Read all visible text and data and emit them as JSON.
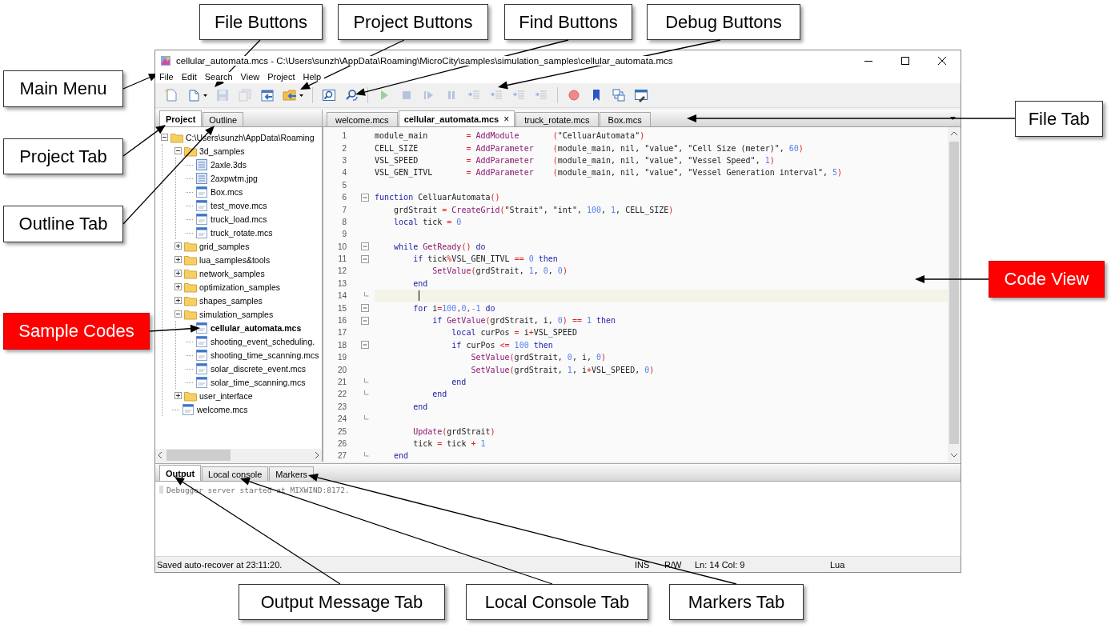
{
  "window": {
    "title": "cellular_automata.mcs - C:\\Users\\sunzh\\AppData\\Roaming\\MicroCity\\samples\\simulation_samples\\cellular_automata.mcs"
  },
  "menu": [
    "File",
    "Edit",
    "Search",
    "View",
    "Project",
    "Help"
  ],
  "toolbar": [
    {
      "kind": "new",
      "disabled": false
    },
    {
      "kind": "open",
      "disabled": false,
      "dropdown": true
    },
    {
      "kind": "save",
      "disabled": true
    },
    {
      "kind": "save-all",
      "disabled": true
    },
    {
      "kind": "import",
      "disabled": false
    },
    {
      "kind": "project",
      "disabled": false,
      "dropdown": true
    },
    {
      "kind": "sep"
    },
    {
      "kind": "find",
      "disabled": false
    },
    {
      "kind": "find-replace",
      "disabled": false
    },
    {
      "kind": "sep"
    },
    {
      "kind": "run",
      "disabled": true
    },
    {
      "kind": "stop",
      "disabled": true
    },
    {
      "kind": "step",
      "disabled": true
    },
    {
      "kind": "pause",
      "disabled": true
    },
    {
      "kind": "lines",
      "disabled": true
    },
    {
      "kind": "lines",
      "disabled": true
    },
    {
      "kind": "lines",
      "disabled": true
    },
    {
      "kind": "lines",
      "disabled": true
    },
    {
      "kind": "sep"
    },
    {
      "kind": "breakpoint",
      "disabled": false
    },
    {
      "kind": "bookmark",
      "disabled": false
    },
    {
      "kind": "windows",
      "disabled": false
    },
    {
      "kind": "window-edit",
      "disabled": false
    }
  ],
  "side_tabs": [
    {
      "label": "Project",
      "selected": true
    },
    {
      "label": "Outline",
      "selected": false
    }
  ],
  "tree": [
    {
      "label": "C:\\Users\\sunzh\\AppData\\Roaming",
      "kind": "folder",
      "expanded": true,
      "children": [
        {
          "label": "3d_samples",
          "kind": "folder",
          "expanded": true,
          "children": [
            {
              "label": "2axle.3ds",
              "kind": "file",
              "current": false
            },
            {
              "label": "2axpwtm.jpg",
              "kind": "file",
              "current": false
            },
            {
              "label": "Box.mcs",
              "kind": "mcs",
              "current": false
            },
            {
              "label": "test_move.mcs",
              "kind": "mcs",
              "current": false
            },
            {
              "label": "truck_load.mcs",
              "kind": "mcs",
              "current": false
            },
            {
              "label": "truck_rotate.mcs",
              "kind": "mcs",
              "current": false
            }
          ]
        },
        {
          "label": "grid_samples",
          "kind": "folder",
          "expanded": false
        },
        {
          "label": "lua_samples&tools",
          "kind": "folder",
          "expanded": false
        },
        {
          "label": "network_samples",
          "kind": "folder",
          "expanded": false
        },
        {
          "label": "optimization_samples",
          "kind": "folder",
          "expanded": false
        },
        {
          "label": "shapes_samples",
          "kind": "folder",
          "expanded": false
        },
        {
          "label": "simulation_samples",
          "kind": "folder",
          "expanded": true,
          "children": [
            {
              "label": "cellular_automata.mcs",
              "kind": "mcs",
              "current": true
            },
            {
              "label": "shooting_event_scheduling.",
              "kind": "mcs",
              "current": false
            },
            {
              "label": "shooting_time_scanning.mcs",
              "kind": "mcs",
              "current": false
            },
            {
              "label": "solar_discrete_event.mcs",
              "kind": "mcs",
              "current": false
            },
            {
              "label": "solar_time_scanning.mcs",
              "kind": "mcs",
              "current": false
            }
          ]
        },
        {
          "label": "user_interface",
          "kind": "folder",
          "expanded": false
        },
        {
          "label": "welcome.mcs",
          "kind": "mcs",
          "current": false
        }
      ]
    }
  ],
  "file_tabs": [
    {
      "label": "welcome.mcs",
      "selected": false
    },
    {
      "label": "cellular_automata.mcs",
      "selected": true,
      "close": "×"
    },
    {
      "label": "truck_rotate.mcs",
      "selected": false
    },
    {
      "label": "Box.mcs",
      "selected": false
    }
  ],
  "code": [
    {
      "n": "1",
      "foldable": false,
      "block_end": false,
      "current": false,
      "tokens": [
        {
          "kind": "plain",
          "text": "module_main        "
        },
        {
          "kind": "operator",
          "text": "= "
        },
        {
          "kind": "function",
          "text": "AddModule       "
        },
        {
          "kind": "operator",
          "text": "("
        },
        {
          "kind": "plain",
          "text": "\"CelluarAutomata\""
        },
        {
          "kind": "operator",
          "text": ")"
        }
      ]
    },
    {
      "n": "2",
      "foldable": false,
      "block_end": false,
      "current": false,
      "tokens": [
        {
          "kind": "plain",
          "text": "CELL_SIZE          "
        },
        {
          "kind": "operator",
          "text": "= "
        },
        {
          "kind": "function",
          "text": "AddParameter    "
        },
        {
          "kind": "operator",
          "text": "("
        },
        {
          "kind": "plain",
          "text": "module_main, nil, \"value\", \"Cell Size (meter)\", "
        },
        {
          "kind": "number",
          "text": "60"
        },
        {
          "kind": "operator",
          "text": ")"
        }
      ]
    },
    {
      "n": "3",
      "foldable": false,
      "block_end": false,
      "current": false,
      "tokens": [
        {
          "kind": "plain",
          "text": "VSL_SPEED          "
        },
        {
          "kind": "operator",
          "text": "= "
        },
        {
          "kind": "function",
          "text": "AddParameter    "
        },
        {
          "kind": "operator",
          "text": "("
        },
        {
          "kind": "plain",
          "text": "module_main, nil, \"value\", \"Vessel Speed\", "
        },
        {
          "kind": "number",
          "text": "1"
        },
        {
          "kind": "operator",
          "text": ")"
        }
      ]
    },
    {
      "n": "4",
      "foldable": false,
      "block_end": false,
      "current": false,
      "tokens": [
        {
          "kind": "plain",
          "text": "VSL_GEN_ITVL       "
        },
        {
          "kind": "operator",
          "text": "= "
        },
        {
          "kind": "function",
          "text": "AddParameter    "
        },
        {
          "kind": "operator",
          "text": "("
        },
        {
          "kind": "plain",
          "text": "module_main, nil, \"value\", \"Vessel Generation interval\", "
        },
        {
          "kind": "number",
          "text": "5"
        },
        {
          "kind": "operator",
          "text": ")"
        }
      ]
    },
    {
      "n": "5",
      "foldable": false,
      "block_end": false,
      "current": false
    },
    {
      "n": "6",
      "foldable": true,
      "block_end": false,
      "current": false,
      "tokens": [
        {
          "kind": "keyword",
          "text": "function"
        },
        {
          "kind": "plain",
          "text": " CelluarAutomata"
        },
        {
          "kind": "operator",
          "text": "()"
        }
      ]
    },
    {
      "n": "7",
      "foldable": false,
      "block_end": false,
      "current": false,
      "tokens": [
        {
          "kind": "plain",
          "text": "    grdStrait "
        },
        {
          "kind": "operator",
          "text": "= "
        },
        {
          "kind": "function",
          "text": "CreateGrid"
        },
        {
          "kind": "operator",
          "text": "("
        },
        {
          "kind": "plain",
          "text": "\"Strait\", \"int\", "
        },
        {
          "kind": "number",
          "text": "100"
        },
        {
          "kind": "plain",
          "text": ", "
        },
        {
          "kind": "number",
          "text": "1"
        },
        {
          "kind": "plain",
          "text": ", CELL_SIZE"
        },
        {
          "kind": "operator",
          "text": ")"
        }
      ]
    },
    {
      "n": "8",
      "foldable": false,
      "block_end": false,
      "current": false,
      "tokens": [
        {
          "kind": "keyword",
          "text": "    local"
        },
        {
          "kind": "plain",
          "text": " tick "
        },
        {
          "kind": "operator",
          "text": "= "
        },
        {
          "kind": "number",
          "text": "0"
        }
      ]
    },
    {
      "n": "9",
      "foldable": false,
      "block_end": false,
      "current": false
    },
    {
      "n": "10",
      "foldable": true,
      "block_end": false,
      "current": false,
      "tokens": [
        {
          "kind": "keyword",
          "text": "    while "
        },
        {
          "kind": "function",
          "text": "GetReady"
        },
        {
          "kind": "operator",
          "text": "() "
        },
        {
          "kind": "keyword",
          "text": "do"
        }
      ]
    },
    {
      "n": "11",
      "foldable": true,
      "block_end": false,
      "current": false,
      "tokens": [
        {
          "kind": "keyword",
          "text": "        if"
        },
        {
          "kind": "plain",
          "text": " tick"
        },
        {
          "kind": "operator",
          "text": "%"
        },
        {
          "kind": "plain",
          "text": "VSL_GEN_ITVL "
        },
        {
          "kind": "operator",
          "text": "== "
        },
        {
          "kind": "number",
          "text": "0 "
        },
        {
          "kind": "keyword",
          "text": "then"
        }
      ]
    },
    {
      "n": "12",
      "foldable": false,
      "block_end": false,
      "current": false,
      "tokens": [
        {
          "kind": "function",
          "text": "            SetValue"
        },
        {
          "kind": "operator",
          "text": "("
        },
        {
          "kind": "plain",
          "text": "grdStrait, "
        },
        {
          "kind": "number",
          "text": "1"
        },
        {
          "kind": "plain",
          "text": ", "
        },
        {
          "kind": "number",
          "text": "0"
        },
        {
          "kind": "plain",
          "text": ", "
        },
        {
          "kind": "number",
          "text": "0"
        },
        {
          "kind": "operator",
          "text": ")"
        }
      ]
    },
    {
      "n": "13",
      "foldable": false,
      "block_end": false,
      "current": false,
      "tokens": [
        {
          "kind": "keyword",
          "text": "        end"
        }
      ]
    },
    {
      "n": "14",
      "foldable": false,
      "block_end": true,
      "current": true
    },
    {
      "n": "15",
      "foldable": true,
      "block_end": false,
      "current": false,
      "tokens": [
        {
          "kind": "keyword",
          "text": "        for"
        },
        {
          "kind": "plain",
          "text": " i"
        },
        {
          "kind": "operator",
          "text": "="
        },
        {
          "kind": "number",
          "text": "100"
        },
        {
          "kind": "operator",
          "text": ","
        },
        {
          "kind": "number",
          "text": "0"
        },
        {
          "kind": "operator",
          "text": ","
        },
        {
          "kind": "number",
          "text": "-1 "
        },
        {
          "kind": "keyword",
          "text": "do"
        }
      ]
    },
    {
      "n": "16",
      "foldable": true,
      "block_end": false,
      "current": false,
      "tokens": [
        {
          "kind": "keyword",
          "text": "            if "
        },
        {
          "kind": "function",
          "text": "GetValue"
        },
        {
          "kind": "operator",
          "text": "("
        },
        {
          "kind": "plain",
          "text": "grdStrait, i, "
        },
        {
          "kind": "number",
          "text": "0"
        },
        {
          "kind": "operator",
          "text": ") == "
        },
        {
          "kind": "number",
          "text": "1 "
        },
        {
          "kind": "keyword",
          "text": "then"
        }
      ]
    },
    {
      "n": "17",
      "foldable": false,
      "block_end": false,
      "current": false,
      "tokens": [
        {
          "kind": "keyword",
          "text": "                local"
        },
        {
          "kind": "plain",
          "text": " curPos "
        },
        {
          "kind": "operator",
          "text": "= "
        },
        {
          "kind": "plain",
          "text": "i"
        },
        {
          "kind": "operator",
          "text": "+"
        },
        {
          "kind": "plain",
          "text": "VSL_SPEED"
        }
      ]
    },
    {
      "n": "18",
      "foldable": true,
      "block_end": false,
      "current": false,
      "tokens": [
        {
          "kind": "keyword",
          "text": "                if"
        },
        {
          "kind": "plain",
          "text": " curPos "
        },
        {
          "kind": "operator",
          "text": "<= "
        },
        {
          "kind": "number",
          "text": "100 "
        },
        {
          "kind": "keyword",
          "text": "then"
        }
      ]
    },
    {
      "n": "19",
      "foldable": false,
      "block_end": false,
      "current": false,
      "tokens": [
        {
          "kind": "function",
          "text": "                    SetValue"
        },
        {
          "kind": "operator",
          "text": "("
        },
        {
          "kind": "plain",
          "text": "grdStrait, "
        },
        {
          "kind": "number",
          "text": "0"
        },
        {
          "kind": "plain",
          "text": ", i, "
        },
        {
          "kind": "number",
          "text": "0"
        },
        {
          "kind": "operator",
          "text": ")"
        }
      ]
    },
    {
      "n": "20",
      "foldable": false,
      "block_end": false,
      "current": false,
      "tokens": [
        {
          "kind": "function",
          "text": "                    SetValue"
        },
        {
          "kind": "operator",
          "text": "("
        },
        {
          "kind": "plain",
          "text": "grdStrait, "
        },
        {
          "kind": "number",
          "text": "1"
        },
        {
          "kind": "plain",
          "text": ", i"
        },
        {
          "kind": "operator",
          "text": "+"
        },
        {
          "kind": "plain",
          "text": "VSL_SPEED, "
        },
        {
          "kind": "number",
          "text": "0"
        },
        {
          "kind": "operator",
          "text": ")"
        }
      ]
    },
    {
      "n": "21",
      "foldable": false,
      "block_end": true,
      "current": false,
      "tokens": [
        {
          "kind": "keyword",
          "text": "                end"
        }
      ]
    },
    {
      "n": "22",
      "foldable": false,
      "block_end": true,
      "current": false,
      "tokens": [
        {
          "kind": "keyword",
          "text": "            end"
        }
      ]
    },
    {
      "n": "23",
      "foldable": false,
      "block_end": false,
      "current": false,
      "tokens": [
        {
          "kind": "keyword",
          "text": "        end"
        }
      ]
    },
    {
      "n": "24",
      "foldable": false,
      "block_end": true,
      "current": false
    },
    {
      "n": "25",
      "foldable": false,
      "block_end": false,
      "current": false,
      "tokens": [
        {
          "kind": "function",
          "text": "        Update"
        },
        {
          "kind": "operator",
          "text": "("
        },
        {
          "kind": "plain",
          "text": "grdStrait"
        },
        {
          "kind": "operator",
          "text": ")"
        }
      ]
    },
    {
      "n": "26",
      "foldable": false,
      "block_end": false,
      "current": false,
      "tokens": [
        {
          "kind": "plain",
          "text": "        tick "
        },
        {
          "kind": "operator",
          "text": "= "
        },
        {
          "kind": "plain",
          "text": "tick "
        },
        {
          "kind": "operator",
          "text": "+ "
        },
        {
          "kind": "number",
          "text": "1"
        }
      ]
    },
    {
      "n": "27",
      "foldable": false,
      "block_end": true,
      "current": false,
      "tokens": [
        {
          "kind": "keyword",
          "text": "    end"
        }
      ]
    }
  ],
  "bottom_tabs": [
    {
      "label": "Output",
      "selected": true
    },
    {
      "label": "Local console",
      "selected": false
    },
    {
      "label": "Markers",
      "selected": false
    }
  ],
  "output": [
    "Debugger server started at MIXWIND:8172."
  ],
  "status_bar": [
    "Saved auto-recover at 23:11:20.",
    "INS",
    "R/W",
    "Ln: 14 Col: 9",
    "Lua"
  ],
  "callouts": [
    {
      "label": "File Buttons",
      "kind": "plain"
    },
    {
      "label": "Project Buttons",
      "kind": "plain"
    },
    {
      "label": "Find Buttons",
      "kind": "plain"
    },
    {
      "label": "Debug Buttons",
      "kind": "plain"
    },
    {
      "label": "Main Menu",
      "kind": "plain"
    },
    {
      "label": "File Tab",
      "kind": "plain"
    },
    {
      "label": "Project Tab",
      "kind": "plain"
    },
    {
      "label": "Outline Tab",
      "kind": "plain"
    },
    {
      "label": "Code View",
      "kind": "highlight"
    },
    {
      "label": "Sample Codes",
      "kind": "highlight"
    },
    {
      "label": "Output Message Tab",
      "kind": "plain"
    },
    {
      "label": "Local Console Tab",
      "kind": "plain"
    },
    {
      "label": "Markers Tab",
      "kind": "plain"
    }
  ]
}
